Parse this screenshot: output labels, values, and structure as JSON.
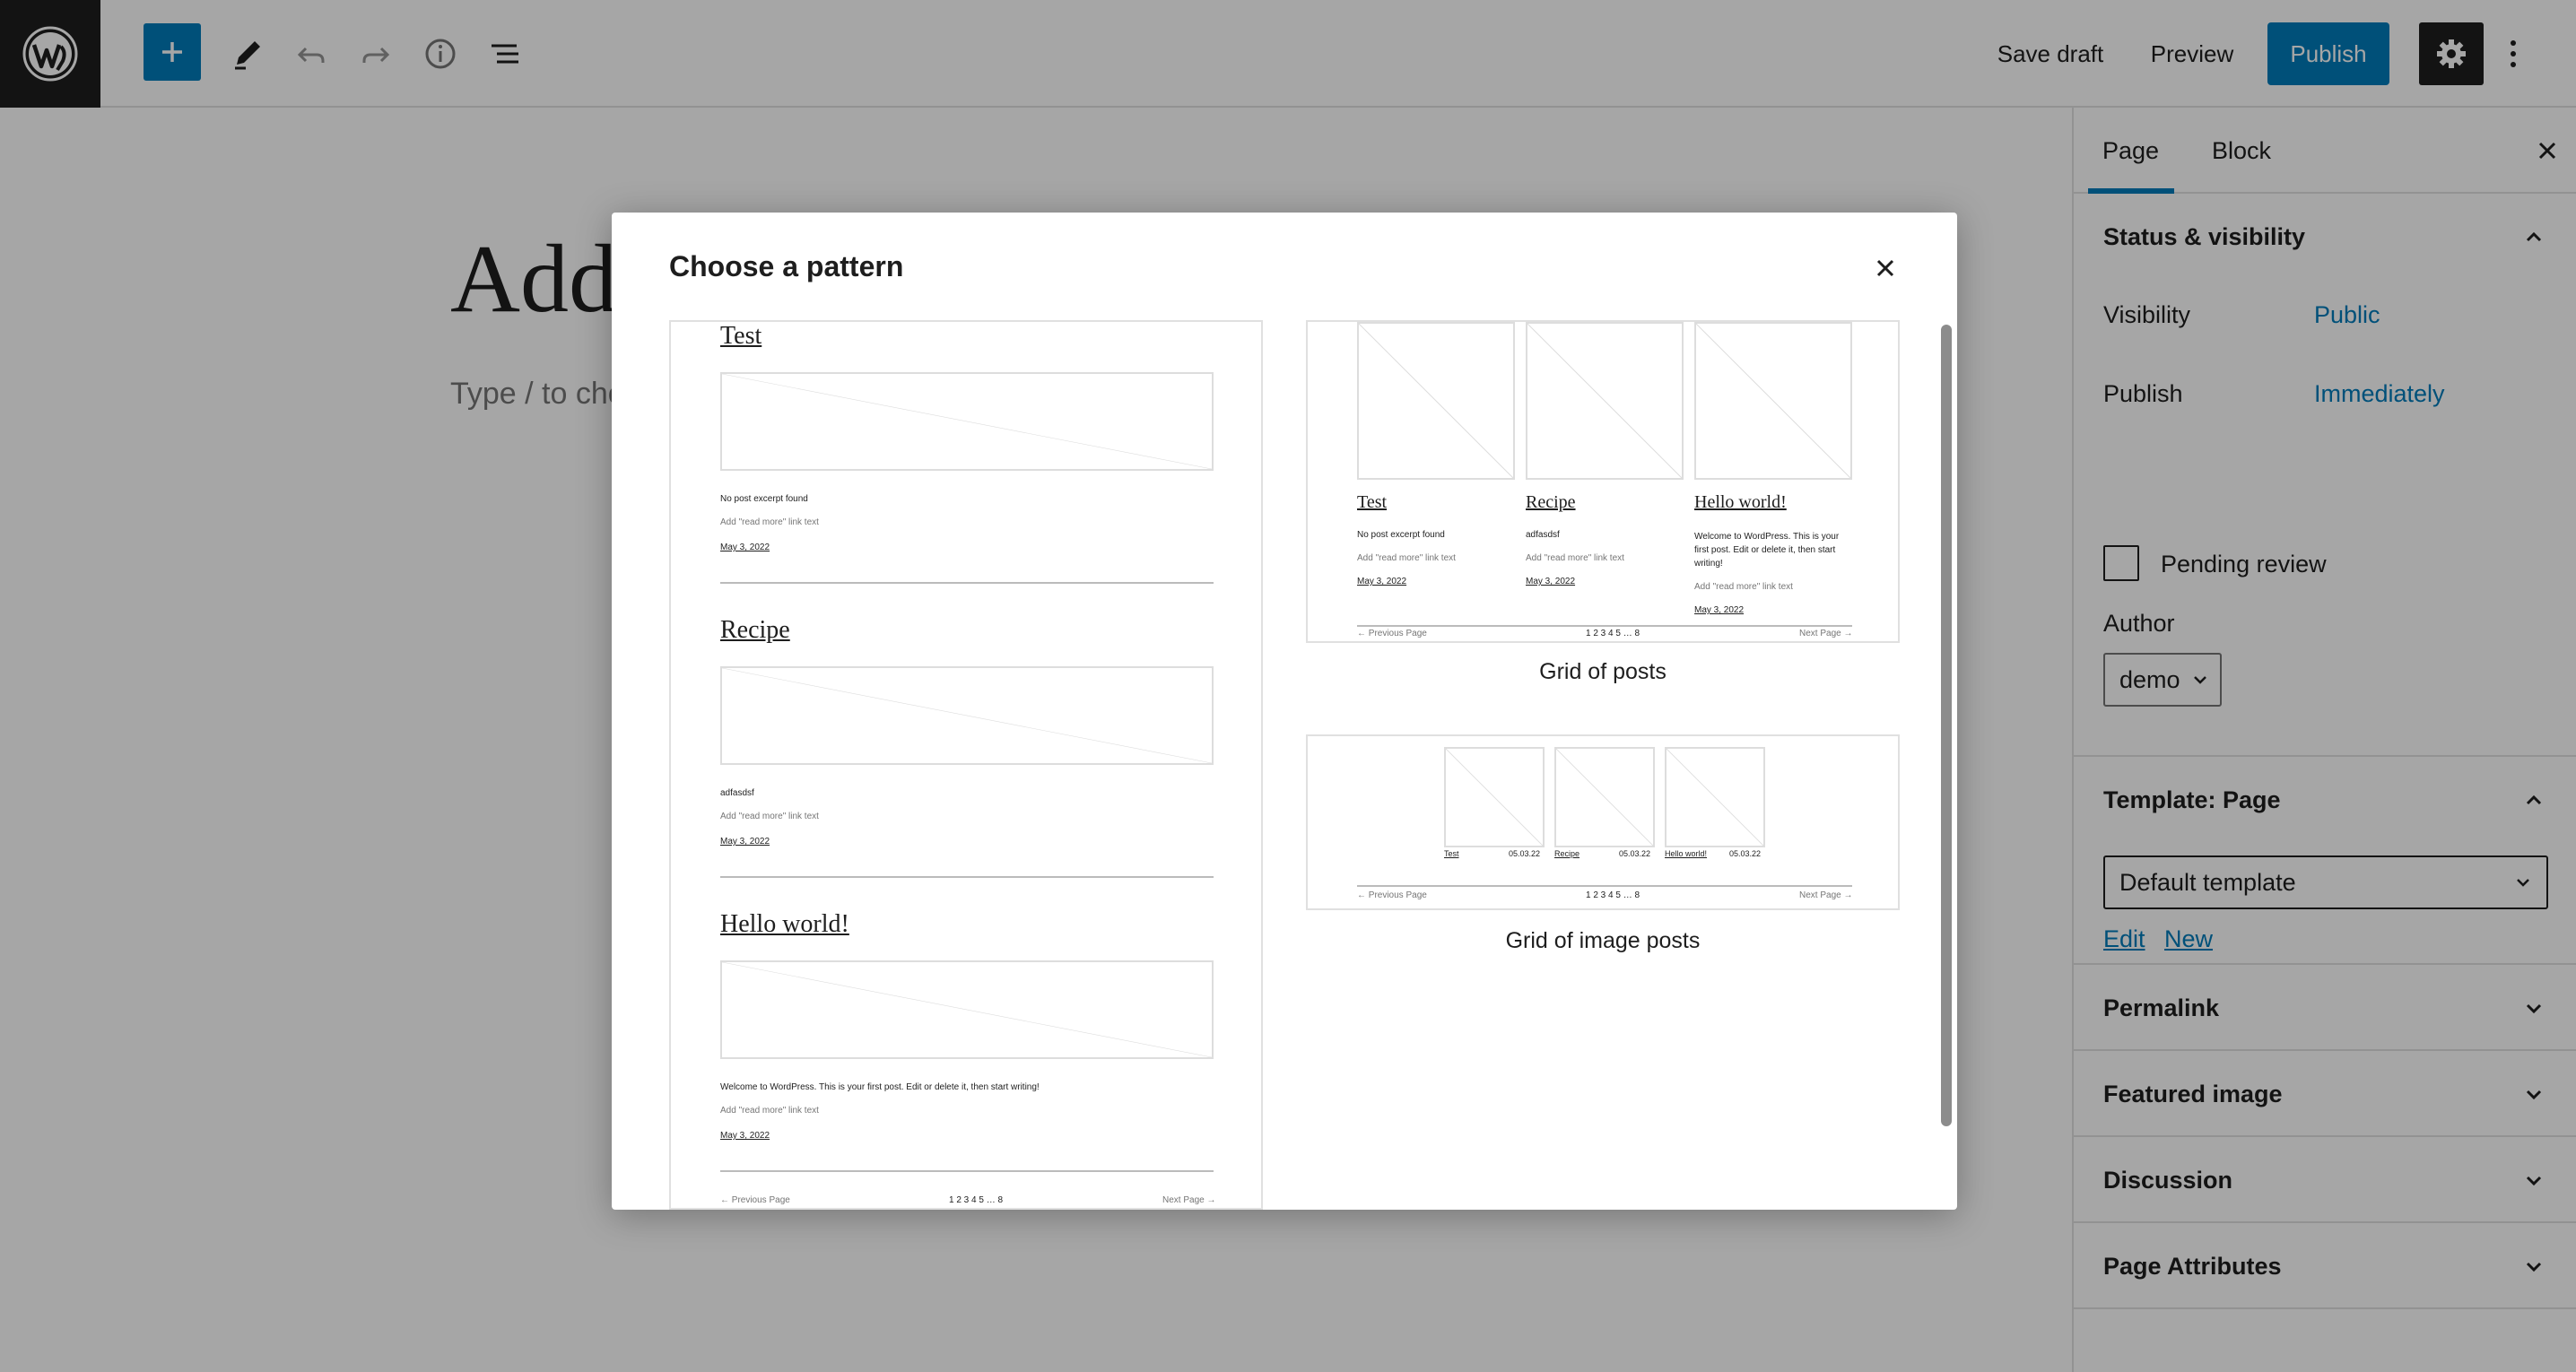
{
  "toolbar": {
    "save_draft": "Save draft",
    "preview": "Preview",
    "publish": "Publish",
    "accent": "#007cba"
  },
  "editor": {
    "title_placeholder": "Add title",
    "paragraph_placeholder": "Type / to choose a block"
  },
  "sidebar": {
    "tab_page": "Page",
    "tab_block": "Block",
    "status_heading": "Status & visibility",
    "visibility_label": "Visibility",
    "visibility_value": "Public",
    "publish_label": "Publish",
    "publish_value": "Immediately",
    "pending_review": "Pending review",
    "author_label": "Author",
    "author_value": "demo",
    "template_heading": "Template: Page",
    "template_value": "Default template",
    "template_edit": "Edit",
    "template_new": "New",
    "permalink": "Permalink",
    "featured_image": "Featured image",
    "discussion": "Discussion",
    "page_attributes": "Page Attributes"
  },
  "modal": {
    "title": "Choose a pattern",
    "patterns": [
      {
        "posts": [
          {
            "title": "Test",
            "excerpt": "No post excerpt found",
            "readmore": "Add \"read more\" link text",
            "date": "May 3, 2022"
          },
          {
            "title": "Recipe",
            "excerpt": "adfasdsf",
            "readmore": "Add \"read more\" link text",
            "date": "May 3, 2022"
          },
          {
            "title": "Hello world!",
            "excerpt": "Welcome to WordPress. This is your first post. Edit or delete it, then start writing!",
            "readmore": "Add \"read more\" link text",
            "date": "May 3, 2022"
          }
        ],
        "pagination": {
          "prev": "← Previous Page",
          "pages": "1 2 3 4 5 … 8",
          "next": "Next Page →"
        }
      },
      {
        "label": "Grid of posts",
        "posts": [
          {
            "title": "Test",
            "excerpt": "No post excerpt found",
            "readmore": "Add \"read more\" link text",
            "date": "May 3, 2022"
          },
          {
            "title": "Recipe",
            "excerpt": "adfasdsf",
            "readmore": "Add \"read more\" link text",
            "date": "May 3, 2022"
          },
          {
            "title": "Hello world!",
            "excerpt": "Welcome to WordPress. This is your first post. Edit or delete it, then start writing!",
            "readmore": "Add \"read more\" link text",
            "date": "May 3, 2022"
          }
        ],
        "pagination": {
          "prev": "← Previous Page",
          "pages": "1 2 3 4 5 … 8",
          "next": "Next Page →"
        }
      },
      {
        "label": "Grid of image posts",
        "posts": [
          {
            "title": "Test",
            "date": "05.03.22"
          },
          {
            "title": "Recipe",
            "date": "05.03.22"
          },
          {
            "title": "Hello world!",
            "date": "05.03.22"
          }
        ],
        "pagination": {
          "prev": "← Previous Page",
          "pages": "1 2 3 4 5 … 8",
          "next": "Next Page →"
        }
      }
    ]
  }
}
